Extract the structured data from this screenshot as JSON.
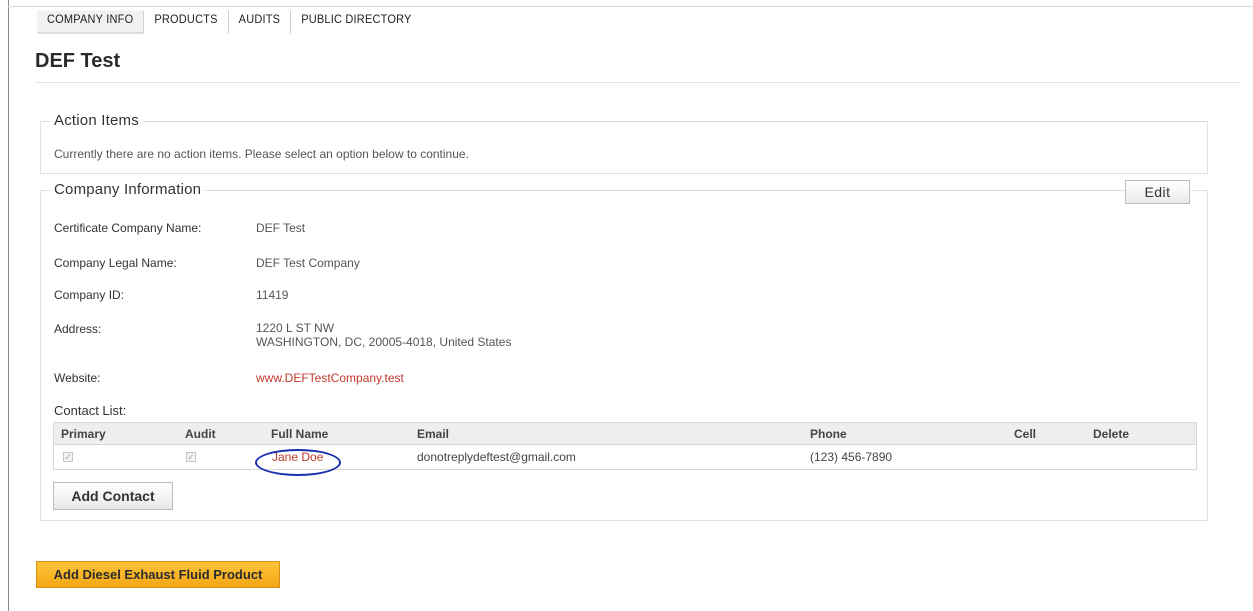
{
  "tabs": [
    {
      "label": "COMPANY INFO",
      "active": true
    },
    {
      "label": "PRODUCTS",
      "active": false
    },
    {
      "label": "AUDITS",
      "active": false
    },
    {
      "label": "PUBLIC DIRECTORY",
      "active": false
    }
  ],
  "page_title": "DEF Test",
  "action_items": {
    "legend": "Action Items",
    "message": "Currently there are no action items. Please select an option below to continue."
  },
  "company_info": {
    "legend": "Company Information",
    "edit_label": "Edit",
    "fields": [
      {
        "label": "Certificate Company Name:",
        "value": "DEF Test"
      },
      {
        "label": "Company Legal Name:",
        "value": "DEF Test Company"
      },
      {
        "label": "Company ID:",
        "value": "11419"
      },
      {
        "label": "Address:",
        "value": "1220 L ST NW",
        "value2": "WASHINGTON, DC, 20005-4018, United States"
      },
      {
        "label": "Website:",
        "value": "www.DEFTestCompany.test"
      }
    ]
  },
  "contacts": {
    "label": "Contact List:",
    "columns": [
      "Primary",
      "Audit",
      "Full Name",
      "Email",
      "Phone",
      "Cell",
      "Delete"
    ],
    "rows": [
      {
        "primary": true,
        "audit": true,
        "full_name": "Jane Doe",
        "email": "donotreplydeftest@gmail.com",
        "phone": "(123) 456-7890",
        "cell": "",
        "delete": ""
      }
    ],
    "add_label": "Add Contact"
  },
  "add_product_label": "Add Diesel Exhaust Fluid Product",
  "colors": {
    "link": "#c0392b",
    "highlight_oval": "#1a2fb0",
    "primary_button": "#f3a614"
  }
}
